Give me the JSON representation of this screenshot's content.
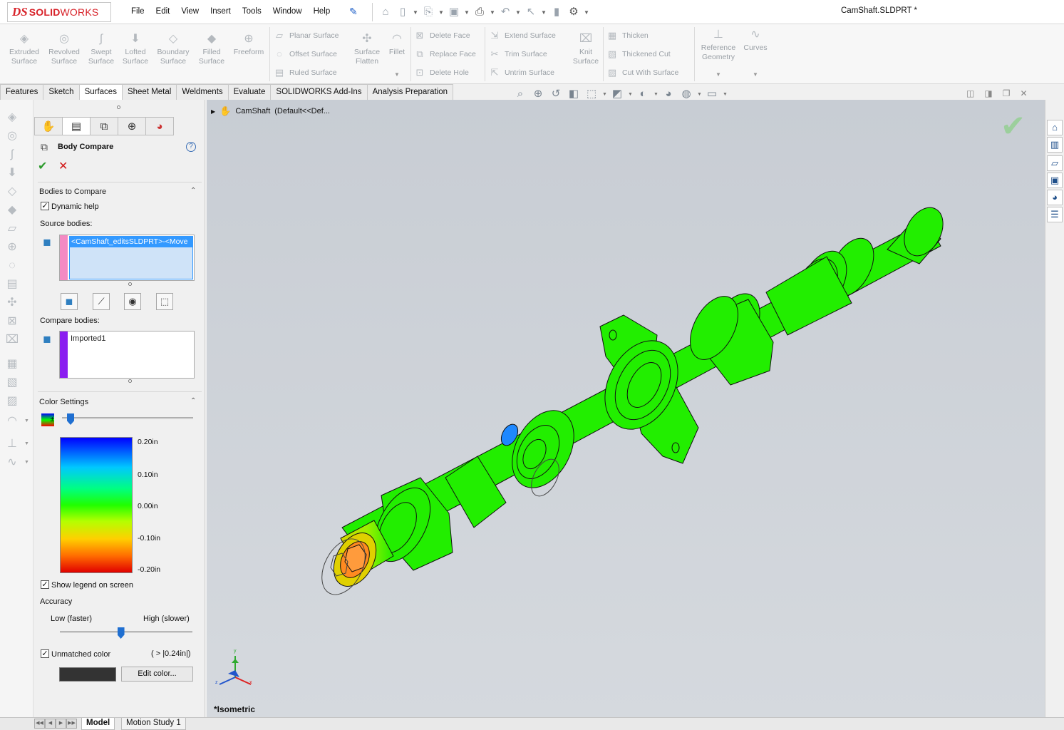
{
  "app": {
    "brand_prefix": "DS",
    "brand_bold": "SOLID",
    "brand_rest": "WORKS",
    "document_title": "CamShaft.SLDPRT *"
  },
  "menus": [
    "File",
    "Edit",
    "View",
    "Insert",
    "Tools",
    "Window",
    "Help"
  ],
  "ribbon": {
    "large": [
      {
        "line1": "Extruded",
        "line2": "Surface",
        "icon": "extruded-surface-icon"
      },
      {
        "line1": "Revolved",
        "line2": "Surface",
        "icon": "revolved-surface-icon"
      },
      {
        "line1": "Swept",
        "line2": "Surface",
        "icon": "swept-surface-icon"
      },
      {
        "line1": "Lofted",
        "line2": "Surface",
        "icon": "lofted-surface-icon"
      },
      {
        "line1": "Boundary",
        "line2": "Surface",
        "icon": "boundary-surface-icon"
      },
      {
        "line1": "Filled",
        "line2": "Surface",
        "icon": "filled-surface-icon"
      },
      {
        "line1": "Freeform",
        "line2": "",
        "icon": "freeform-icon"
      }
    ],
    "group1": [
      "Planar Surface",
      "Offset Surface",
      "Ruled Surface"
    ],
    "surface_flatten": {
      "line1": "Surface",
      "line2": "Flatten"
    },
    "fillet": "Fillet",
    "group2": [
      "Delete Face",
      "Replace Face",
      "Delete Hole"
    ],
    "group3": [
      "Extend Surface",
      "Trim Surface",
      "Untrim Surface"
    ],
    "knit": {
      "line1": "Knit",
      "line2": "Surface"
    },
    "group4": [
      "Thicken",
      "Thickened Cut",
      "Cut With Surface"
    ],
    "reference_geometry": {
      "line1": "Reference",
      "line2": "Geometry"
    },
    "curves": "Curves"
  },
  "tabs": [
    "Features",
    "Sketch",
    "Surfaces",
    "Sheet Metal",
    "Weldments",
    "Evaluate",
    "SOLIDWORKS Add-Ins",
    "Analysis Preparation"
  ],
  "active_tab": "Surfaces",
  "property_manager": {
    "title": "Body Compare",
    "help": "?",
    "bodies_section": "Bodies to Compare",
    "dynamic_help": "Dynamic help",
    "source_label": "Source bodies:",
    "source_item": "<CamShaft_editsSLDPRT>-<Move",
    "compare_label": "Compare bodies:",
    "compare_item": "Imported1",
    "color_section": "Color Settings",
    "legend_values": [
      "0.20in",
      "0.10in",
      "0.00in",
      "-0.10in",
      "-0.20in"
    ],
    "show_legend": "Show legend on screen",
    "accuracy_label": "Accuracy",
    "accuracy_low": "Low (faster)",
    "accuracy_high": "High (slower)",
    "accuracy_level": 0.46,
    "unmatched_label": "Unmatched color",
    "unmatched_value": "( > |0.24in|)",
    "edit_color": "Edit color...",
    "colors": {
      "source": "#f48ac3",
      "compare": "#8a1ef0",
      "unmatched": "#333333"
    }
  },
  "viewport": {
    "tree_root": "CamShaft",
    "tree_config": "(Default<<Def...",
    "view_name": "*Isometric",
    "model_color": "#22ee00",
    "axes": {
      "x": "x",
      "y": "y",
      "z": "z"
    }
  },
  "bottom_tabs": [
    "Model",
    "Motion Study 1"
  ],
  "active_bottom_tab": "Model"
}
